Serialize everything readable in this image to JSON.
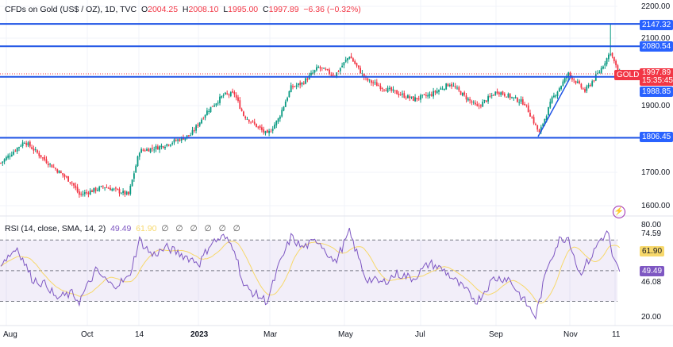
{
  "header": {
    "symbol": "CFDs on Gold (US$ / OZ), 1D, TVC",
    "o_label": "O",
    "o": "2004.25",
    "h_label": "H",
    "h": "2008.10",
    "l_label": "L",
    "l": "1995.00",
    "c_label": "C",
    "c": "1997.89",
    "change": "−6.36 (−0.32%)"
  },
  "rsi": {
    "label": "RSI (14, close, SMA, 14, 2)",
    "value": "49.49",
    "sma": "61.90",
    "extras": "∅ ∅ ∅ ∅ ∅ ∅"
  },
  "price_axis": [
    "2200.00",
    "2100.00",
    "1900.00",
    "1700.00",
    "1600.00"
  ],
  "rsi_axis": [
    "80.00",
    "74.59",
    "46.08",
    "20.00"
  ],
  "levels": [
    {
      "value": 2147.32,
      "label": "2147.32"
    },
    {
      "value": 2080.54,
      "label": "2080.54"
    },
    {
      "value": 1988.85,
      "label": "1988.85"
    },
    {
      "value": 1806.45,
      "label": "1806.45"
    }
  ],
  "current": {
    "symbol": "GOLD",
    "price": "1997.89",
    "countdown": "15:35:45",
    "value": 1997.89
  },
  "rsi_tags": {
    "sma": "61.90",
    "rsi": "49.49"
  },
  "x_labels": [
    "Aug",
    "Oct",
    "14",
    "2023",
    "Mar",
    "May",
    "Jul",
    "Sep",
    "Nov",
    "11"
  ],
  "colors": {
    "up": "#089981",
    "down": "#f23645",
    "line": "#1e53e5",
    "rsi": "#7e57c2",
    "sma": "#f7d86b",
    "tag": "#2962ff"
  },
  "chart_data": {
    "type": "candlestick",
    "price_waypoints": [
      [
        0,
        1731
      ],
      [
        13,
        1796
      ],
      [
        26,
        1731
      ],
      [
        39,
        1672
      ],
      [
        43,
        1636
      ],
      [
        57,
        1660
      ],
      [
        70,
        1636
      ],
      [
        76,
        1767
      ],
      [
        87,
        1779
      ],
      [
        104,
        1815
      ],
      [
        113,
        1886
      ],
      [
        122,
        1934
      ],
      [
        128,
        1938
      ],
      [
        133,
        1874
      ],
      [
        146,
        1815
      ],
      [
        152,
        1862
      ],
      [
        159,
        1957
      ],
      [
        165,
        1969
      ],
      [
        174,
        2017
      ],
      [
        183,
        1993
      ],
      [
        191,
        2052
      ],
      [
        200,
        1981
      ],
      [
        209,
        1957
      ],
      [
        226,
        1922
      ],
      [
        235,
        1934
      ],
      [
        246,
        1969
      ],
      [
        261,
        1898
      ],
      [
        272,
        1946
      ],
      [
        287,
        1910
      ],
      [
        295,
        1820
      ],
      [
        302,
        1922
      ],
      [
        311,
        1998
      ],
      [
        320,
        1946
      ],
      [
        328,
        2005
      ],
      [
        334,
        2064
      ],
      [
        337,
        2019
      ],
      [
        339,
        1998
      ]
    ],
    "rsi_waypoints": [
      [
        0,
        55
      ],
      [
        9,
        65
      ],
      [
        17,
        45
      ],
      [
        26,
        40
      ],
      [
        30,
        32
      ],
      [
        39,
        35
      ],
      [
        43,
        30
      ],
      [
        52,
        50
      ],
      [
        61,
        40
      ],
      [
        70,
        45
      ],
      [
        76,
        70
      ],
      [
        83,
        60
      ],
      [
        91,
        65
      ],
      [
        100,
        60
      ],
      [
        109,
        55
      ],
      [
        115,
        68
      ],
      [
        122,
        72
      ],
      [
        128,
        65
      ],
      [
        133,
        40
      ],
      [
        139,
        35
      ],
      [
        146,
        30
      ],
      [
        152,
        52
      ],
      [
        159,
        72
      ],
      [
        165,
        65
      ],
      [
        174,
        70
      ],
      [
        183,
        55
      ],
      [
        191,
        75
      ],
      [
        200,
        45
      ],
      [
        209,
        42
      ],
      [
        217,
        48
      ],
      [
        226,
        45
      ],
      [
        235,
        55
      ],
      [
        243,
        50
      ],
      [
        252,
        40
      ],
      [
        261,
        30
      ],
      [
        270,
        45
      ],
      [
        278,
        45
      ],
      [
        287,
        30
      ],
      [
        293,
        20
      ],
      [
        300,
        55
      ],
      [
        306,
        70
      ],
      [
        311,
        72
      ],
      [
        317,
        48
      ],
      [
        324,
        60
      ],
      [
        328,
        70
      ],
      [
        333,
        75
      ],
      [
        335,
        58
      ],
      [
        339,
        49.49
      ]
    ],
    "ylim": [
      1600,
      2200
    ],
    "rsi_ylim": [
      20,
      80
    ],
    "rsi_bands": [
      30,
      50,
      70
    ]
  }
}
